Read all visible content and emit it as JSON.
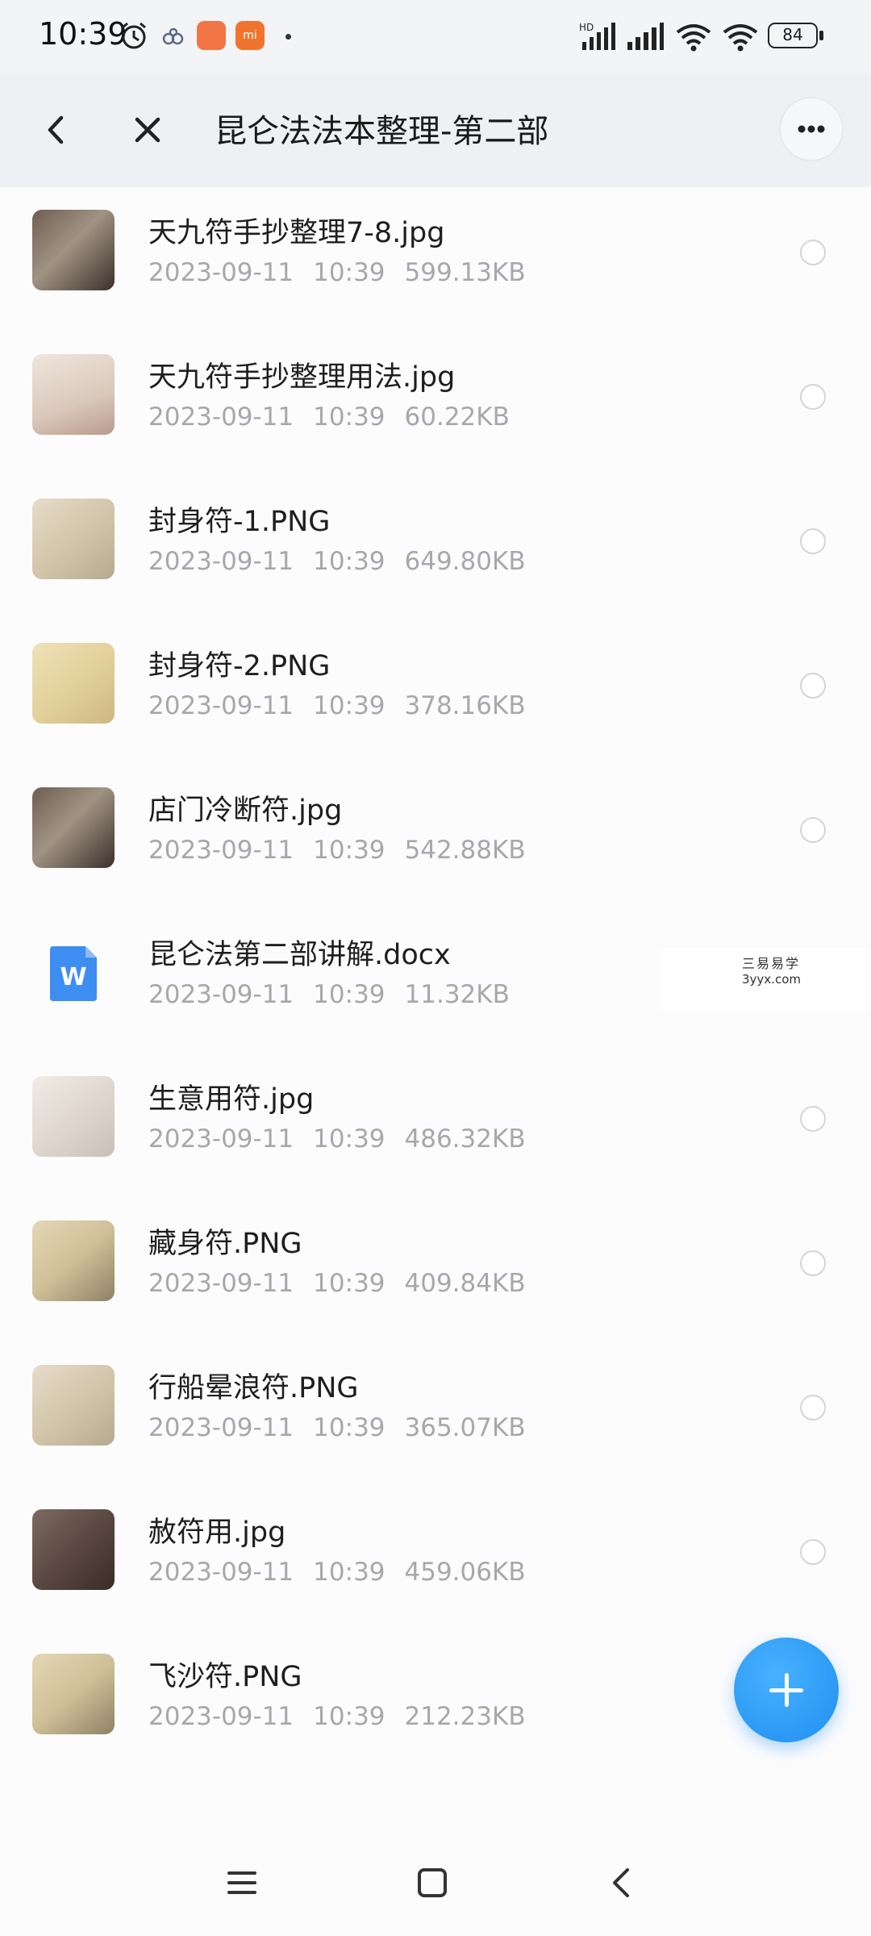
{
  "status_bar": {
    "time": "10:39",
    "icons": [
      "alarm-icon",
      "app-notification-icon",
      "mi-store-icon",
      "mi-app-icon",
      "dot-icon",
      "hd-signal-icon",
      "signal-icon",
      "wifi-icon",
      "wifi-icon"
    ],
    "battery": "84"
  },
  "header": {
    "title": "昆仑法法本整理-第二部",
    "back_icon": "back-chevron-icon",
    "close_icon": "close-icon",
    "more_icon": "more-icon"
  },
  "files": [
    {
      "name": "天九符手抄整理7-8.jpg",
      "date": "2023-09-11",
      "time": "10:39",
      "size": "599.13KB",
      "thumb": "dark-photo"
    },
    {
      "name": "天九符手抄整理用法.jpg",
      "date": "2023-09-11",
      "time": "10:39",
      "size": "60.22KB",
      "thumb": "red-notes"
    },
    {
      "name": "封身符-1.PNG",
      "date": "2023-09-11",
      "time": "10:39",
      "size": "649.80KB",
      "thumb": "paper"
    },
    {
      "name": "封身符-2.PNG",
      "date": "2023-09-11",
      "time": "10:39",
      "size": "378.16KB",
      "thumb": "yellow-paper"
    },
    {
      "name": "店门冷断符.jpg",
      "date": "2023-09-11",
      "time": "10:39",
      "size": "542.88KB",
      "thumb": "dark-photo"
    },
    {
      "name": "昆仑法第二部讲解.docx",
      "date": "2023-09-11",
      "time": "10:39",
      "size": "11.32KB",
      "thumb": "word-doc"
    },
    {
      "name": "生意用符.jpg",
      "date": "2023-09-11",
      "time": "10:39",
      "size": "486.32KB",
      "thumb": "light-paper"
    },
    {
      "name": "藏身符.PNG",
      "date": "2023-09-11",
      "time": "10:39",
      "size": "409.84KB",
      "thumb": "ink-paper"
    },
    {
      "name": "行船晕浪符.PNG",
      "date": "2023-09-11",
      "time": "10:39",
      "size": "365.07KB",
      "thumb": "paper"
    },
    {
      "name": "赦符用.jpg",
      "date": "2023-09-11",
      "time": "10:39",
      "size": "459.06KB",
      "thumb": "brown-photo"
    },
    {
      "name": "飞沙符.PNG",
      "date": "2023-09-11",
      "time": "10:39",
      "size": "212.23KB",
      "thumb": "ink-paper"
    }
  ],
  "watermark": {
    "line1": "三易易学",
    "line2": "3yyx.com"
  },
  "fab_icon": "plus-icon",
  "nav": {
    "icons": [
      "menu-icon",
      "home-icon",
      "back-icon"
    ]
  },
  "colors": {
    "accent": "#2a9af5",
    "secondary_text": "#a6a8ad",
    "header_bg": "#eef0f3"
  }
}
